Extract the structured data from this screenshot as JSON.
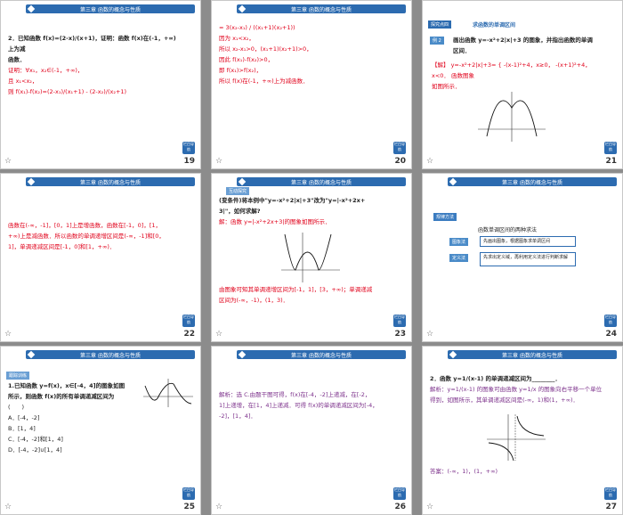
{
  "header": "第三章  函数的概念与性质",
  "back_label": "栏目导航",
  "star_icon": "☆",
  "slides": [
    {
      "page": "19",
      "lines": [
        "2．已知函数 f(x)=(2-x)/(x+1)，证明：函数 f(x)在(-1，+∞)上为减",
        "函数．",
        "证明：∀x₁，x₂∈(-1，+∞)，",
        "且 x₁<x₂，",
        "则 f(x₁)-f(x₂)=(2-x₁)/(x₁+1) - (2-x₂)/(x₂+1)"
      ]
    },
    {
      "page": "20",
      "lines": [
        "= 3(x₂-x₁) / ((x₁+1)(x₂+1))",
        "因为 x₁<x₂，",
        "所以 x₂-x₁>0，(x₁+1)(x₂+1)>0，",
        "因此 f(x₁)-f(x₂)>0，",
        "即 f(x₁)>f(x₂)，",
        "所以 f(x)在(-1，+∞)上为减函数．"
      ]
    },
    {
      "page": "21",
      "tag": "探究点四",
      "tag_title": "求函数的单调区间",
      "example": "例 2",
      "lines": [
        "画出函数 y=-x²+2|x|+3 的图象，并指出函数的单调",
        "区间．",
        "【解】 y=-x²+2|x|+3= { -(x-1)²+4，x≥0，  -(x+1)²+4，x<0． 函数图象",
        "如图所示．"
      ]
    },
    {
      "page": "22",
      "lines": [
        "函数在(-∞，-1]，[0，1]上是增函数，函数在[-1，0]，[1，",
        "+∞)上是减函数．所以函数的单调递增区间是(-∞，-1]和[0，",
        "1]，单调递减区间是[-1，0]和[1，+∞)．"
      ]
    },
    {
      "page": "23",
      "tag": "互动探究",
      "lines": [
        "(变条件)将本例中\"y=-x²+2|x|+3\"改为\"y=|-x²+2x+",
        "3|\"，如何求解?",
        "解：函数 y=|-x²+2x+3|的图象如图所示．",
        "由图象可知其单调递增区间为[-1，1]，[3，+∞)；单调递减",
        "区间为(-∞，-1)，(1，3)．"
      ]
    },
    {
      "page": "24",
      "tag": "规律方法",
      "title": "函数单调区间的两种求法",
      "methods": [
        {
          "name": "图象法",
          "desc": "先画出图象，根据图象求单调区间"
        },
        {
          "name": "定义法",
          "desc": "先求出定义域，再利用定义法进行判断求解"
        }
      ]
    },
    {
      "page": "25",
      "tag": "跟踪训练",
      "lines": [
        "1.已知函数 y=f(x)，x∈[-4，4]的图象如图",
        "所示，则函数 f(x)的所有单调递减区间为",
        "(　　)",
        "A．[-4，-2]",
        "B．[1，4]",
        "C．[-4，-2]和[1，4]",
        "D．[-4，-2]∪[1，4]"
      ]
    },
    {
      "page": "26",
      "lines": [
        "解析：选 C.由题干图可得，f(x)在[-4，-2]上递减，在[-2，",
        "1]上递增，在[1，4]上递减．可得 f(x)的单调递减区间为[-4，",
        "-2]，[1，4]．"
      ]
    },
    {
      "page": "27",
      "lines": [
        "2．函数 y=1/(x-1) 的单调递减区间为________．",
        "解析：y=1/(x-1) 的图象可由函数 y=1/x 的图象向右平移一个单位",
        "得到，如图所示，其单调递减区间是(-∞，1)和(1，+∞)．",
        "答案：(-∞，1)，(1，+∞)"
      ]
    }
  ]
}
